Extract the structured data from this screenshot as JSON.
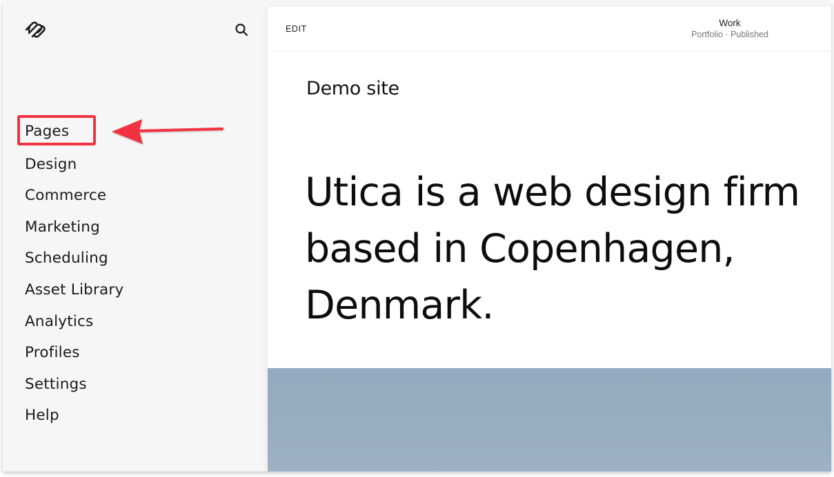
{
  "sidebar": {
    "logo_icon": "squarespace-logo-icon",
    "search_icon": "search-icon",
    "items": [
      {
        "label": "Pages",
        "highlighted": true
      },
      {
        "label": "Design"
      },
      {
        "label": "Commerce"
      },
      {
        "label": "Marketing"
      },
      {
        "label": "Scheduling"
      },
      {
        "label": "Asset Library"
      },
      {
        "label": "Analytics"
      },
      {
        "label": "Profiles"
      },
      {
        "label": "Settings"
      },
      {
        "label": "Help"
      }
    ]
  },
  "annotation": {
    "highlight_color": "#f2323f",
    "target": "Pages",
    "arrow_direction": "left"
  },
  "content": {
    "toolbar": {
      "edit_label": "EDIT",
      "page_title": "Work",
      "page_subtitle": "Portfolio · Published"
    },
    "site_name": "Demo site",
    "headline_lines": [
      "Utica is a web design firm",
      "based in Copenhagen,",
      "Denmark."
    ],
    "hero_image_color": "#97acbf"
  }
}
